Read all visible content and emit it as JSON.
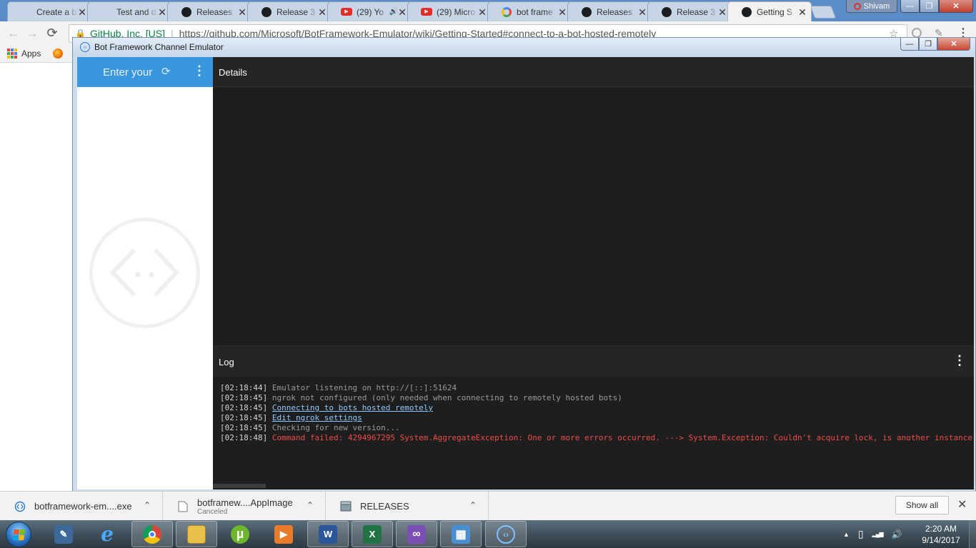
{
  "browser": {
    "tabs": [
      {
        "title": "Create a b",
        "icon": "microsoft-icon",
        "active": false
      },
      {
        "title": "Test and d",
        "icon": "microsoft-icon",
        "active": false
      },
      {
        "title": "Releases",
        "icon": "github-icon",
        "active": false
      },
      {
        "title": "Release 3",
        "icon": "github-icon",
        "active": false
      },
      {
        "title": "(29) Yo",
        "icon": "youtube-icon",
        "active": false,
        "audio": "🔊"
      },
      {
        "title": "(29) Micro",
        "icon": "youtube-icon",
        "active": false
      },
      {
        "title": "bot frame",
        "icon": "google-icon",
        "active": false
      },
      {
        "title": "Releases",
        "icon": "github-icon",
        "active": false
      },
      {
        "title": "Release 3",
        "icon": "github-icon",
        "active": false
      },
      {
        "title": "Getting S",
        "icon": "github-icon",
        "active": true
      }
    ],
    "tab_close": "✕",
    "profile_name": "Shivam",
    "window_controls": {
      "minimize": "—",
      "maximize": "❐",
      "close": "✕"
    },
    "nav": {
      "back": "←",
      "forward": "→",
      "reload": "⟳"
    },
    "address": {
      "lock": "🔒",
      "ev_label": "GitHub, Inc. [US]",
      "separator": "|",
      "url": "https://github.com/Microsoft/BotFramework-Emulator/wiki/Getting-Started#connect-to-a-bot-hosted-remotely"
    },
    "star": "☆",
    "menu": "⋮",
    "bookmarks": {
      "apps_label": "Apps"
    }
  },
  "emulator": {
    "window_title": "Bot Framework Channel Emulator",
    "window_controls": {
      "minimize": "—",
      "maximize": "❐",
      "close": "✕"
    },
    "address_placeholder": "Enter your",
    "refresh_icon": "⟳",
    "menu_icon": "⋮",
    "details_title": "Details",
    "log_title": "Log",
    "log_menu_icon": "⋮",
    "log": [
      {
        "time": "[02:18:44]",
        "message": "Emulator listening on http://[::]:51624",
        "kind": "normal"
      },
      {
        "time": "[02:18:45]",
        "message": "ngrok not configured (only needed when connecting to remotely hosted bots)",
        "kind": "normal"
      },
      {
        "time": "[02:18:45]",
        "message": "Connecting to bots hosted remotely",
        "kind": "link"
      },
      {
        "time": "[02:18:45]",
        "message": "Edit ngrok settings",
        "kind": "link"
      },
      {
        "time": "[02:18:45]",
        "message": "Checking for new version...",
        "kind": "normal"
      },
      {
        "time": "[02:18:48]",
        "message": "Command failed: 4294967295 System.AggregateException: One or more errors occurred. ---> System.Exception: Couldn't acquire lock, is another instance",
        "kind": "error"
      }
    ]
  },
  "downloads": {
    "items": [
      {
        "name": "botframework-em....exe",
        "status": "",
        "icon": "emulator-icon"
      },
      {
        "name": "botframew....AppImage",
        "status": "Canceled",
        "icon": "file-icon"
      },
      {
        "name": "RELEASES",
        "status": "",
        "icon": "package-icon"
      }
    ],
    "chevron": "⌃",
    "show_all_label": "Show all",
    "close": "✕"
  },
  "taskbar": {
    "apps": [
      {
        "name": "ie-icon",
        "glyph": "e",
        "color": "#1f7fd8"
      },
      {
        "name": "chrome-icon",
        "glyph": "",
        "color": "#db4437"
      },
      {
        "name": "explorer-icon",
        "glyph": "",
        "color": "#e8c04a"
      },
      {
        "name": "utorrent-icon",
        "glyph": "µ",
        "color": "#6cb72a"
      },
      {
        "name": "media-player-icon",
        "glyph": "▶",
        "color": "#e87c2b"
      },
      {
        "name": "word-icon",
        "glyph": "W",
        "color": "#2b579a"
      },
      {
        "name": "excel-icon",
        "glyph": "X",
        "color": "#217346"
      },
      {
        "name": "visual-studio-icon",
        "glyph": "∞",
        "color": "#7b4fb3"
      },
      {
        "name": "control-panel-icon",
        "glyph": "▦",
        "color": "#4a8fd1"
      },
      {
        "name": "bot-emulator-icon",
        "glyph": "‹›",
        "color": "#3a96dd"
      }
    ],
    "tray": {
      "arrow": "▲",
      "battery": "▯",
      "network": "▂▄▆",
      "volume": "🔊"
    },
    "time": "2:20 AM",
    "date": "9/14/2017"
  }
}
